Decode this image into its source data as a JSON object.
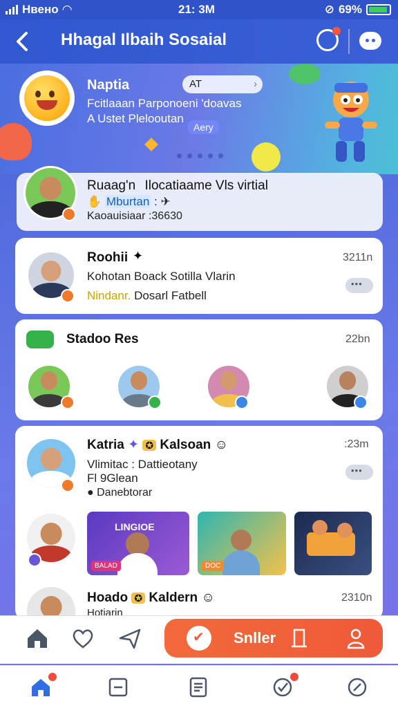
{
  "status_bar": {
    "carrier": "Hвено",
    "time": "21: 3M",
    "battery": "69%"
  },
  "header": {
    "title": "Hhagal Ilbaih Sosaial",
    "back_icon": "chevron-left-icon",
    "notifications_icon": "bell-icon",
    "chat_icon": "chat-bubble-icon"
  },
  "hero": {
    "name": "Naptia",
    "chip": "AT",
    "line1": "Fcitlaaan Parponoeni 'doavas",
    "line2": "A Ustet Plelooutan",
    "tag": "Aery"
  },
  "cards": {
    "first": {
      "name": "Ruaag'n",
      "title_rest": "Ilocatiaame Vls virtial",
      "highlight": "Mburtan",
      "line3": "Kaoauisiaar :36630"
    },
    "second": {
      "name": "Roohii",
      "time": "3211n",
      "line2": "Kohotan   Boack Sotilla Vlarin",
      "line3_yellow": "Nindanr.",
      "line3_rest": "Dosarl Fatbell"
    },
    "stories": {
      "title": "Stadoo Res",
      "time": "22bn"
    },
    "post1": {
      "name": "Katria",
      "name2": "Kalsoan",
      "time": ":23m",
      "line2": "Vlimitac :  Dattieotany",
      "line3": "Fl 9Glean",
      "line4": "Danebtorar"
    },
    "post2": {
      "name": "Hoado",
      "name2": "Kaldern",
      "time": "2310n",
      "line2": "Hotiarin",
      "thumbs": [
        "LINGIOE",
        "DOC",
        "BALAD"
      ]
    }
  },
  "action_bar": {
    "cta_label": "Snller"
  },
  "colors": {
    "brand": "#3158d0",
    "accent": "#ef5a3a",
    "background": "#6a7ae8"
  }
}
